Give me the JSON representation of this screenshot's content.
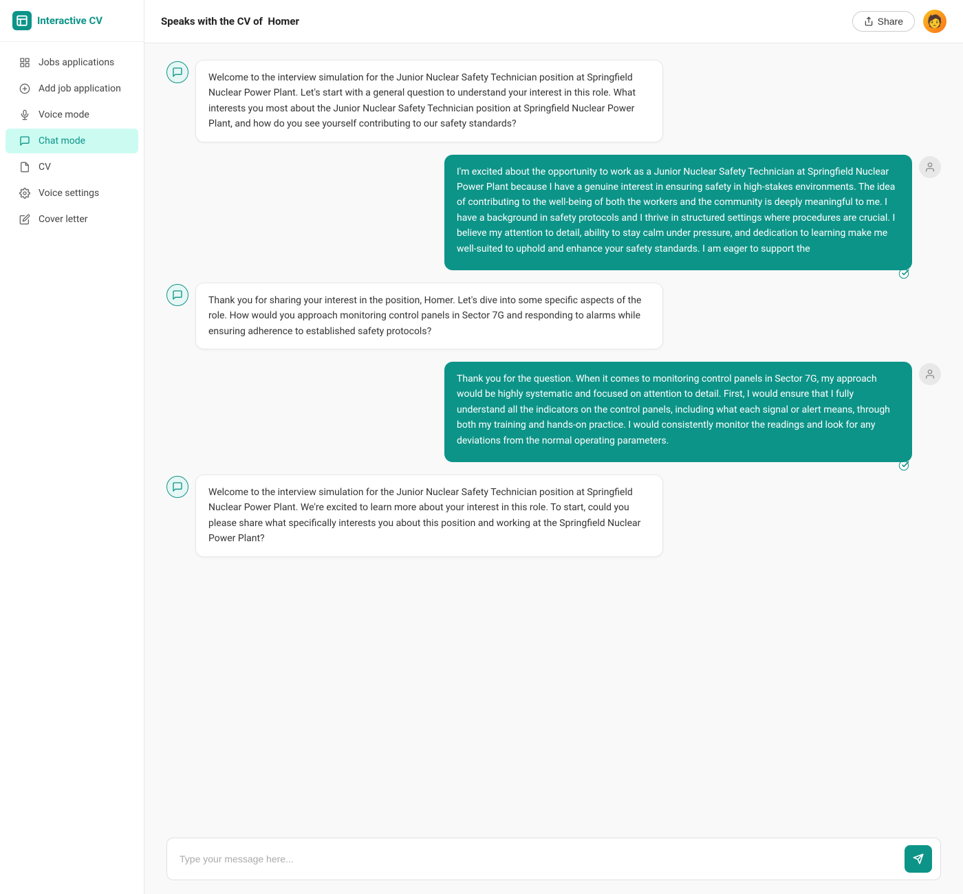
{
  "app": {
    "title": "Interactive CV",
    "logo_icon": "📋"
  },
  "header": {
    "speaks_with_label": "Speaks with the CV of",
    "user_name": "Homer",
    "share_button_label": "Share"
  },
  "sidebar": {
    "items": [
      {
        "id": "jobs-applications",
        "label": "Jobs applications",
        "icon": "grid"
      },
      {
        "id": "add-job-application",
        "label": "Add job application",
        "icon": "plus-circle"
      },
      {
        "id": "voice-mode",
        "label": "Voice mode",
        "icon": "mic"
      },
      {
        "id": "chat-mode",
        "label": "Chat mode",
        "icon": "chat",
        "active": true
      },
      {
        "id": "cv",
        "label": "CV",
        "icon": "file"
      },
      {
        "id": "voice-settings",
        "label": "Voice settings",
        "icon": "settings"
      },
      {
        "id": "cover-letter",
        "label": "Cover letter",
        "icon": "edit"
      }
    ]
  },
  "messages": [
    {
      "id": "msg1",
      "type": "bot",
      "text": "Welcome to the interview simulation for the Junior Nuclear Safety Technician position at Springfield Nuclear Power Plant. Let's start with a general question to understand your interest in this role. What interests you most about the Junior Nuclear Safety Technician position at Springfield Nuclear Power Plant, and how do you see yourself contributing to our safety standards?"
    },
    {
      "id": "msg2",
      "type": "user",
      "text": "I'm excited about the opportunity to work as a Junior Nuclear Safety Technician at Springfield Nuclear Power Plant because I have a genuine interest in ensuring safety in high-stakes environments. The idea of contributing to the well-being of both the workers and the community is deeply meaningful to me. I have a background in safety protocols and I thrive in structured settings where procedures are crucial. I believe my attention to detail, ability to stay calm under pressure, and dedication to learning make me well-suited to uphold and enhance your safety standards. I am eager to support the"
    },
    {
      "id": "msg3",
      "type": "bot",
      "text": "Thank you for sharing your interest in the position, Homer. Let's dive into some specific aspects of the role. How would you approach monitoring control panels in Sector 7G and responding to alarms while ensuring adherence to established safety protocols?"
    },
    {
      "id": "msg4",
      "type": "user",
      "text": "Thank you for the question. When it comes to monitoring control panels in Sector 7G, my approach would be highly systematic and focused on attention to detail. First, I would ensure that I fully understand all the indicators on the control panels, including what each signal or alert means, through both my training and hands-on practice. I would consistently monitor the readings and look for any deviations from the normal operating parameters."
    },
    {
      "id": "msg5",
      "type": "bot",
      "text": "Welcome to the interview simulation for the Junior Nuclear Safety Technician position at Springfield Nuclear Power Plant. We're excited to learn more about your interest in this role. To start, could you please share what specifically interests you about this position and working at the Springfield Nuclear Power Plant?"
    }
  ],
  "input": {
    "placeholder": "Type your message here..."
  }
}
